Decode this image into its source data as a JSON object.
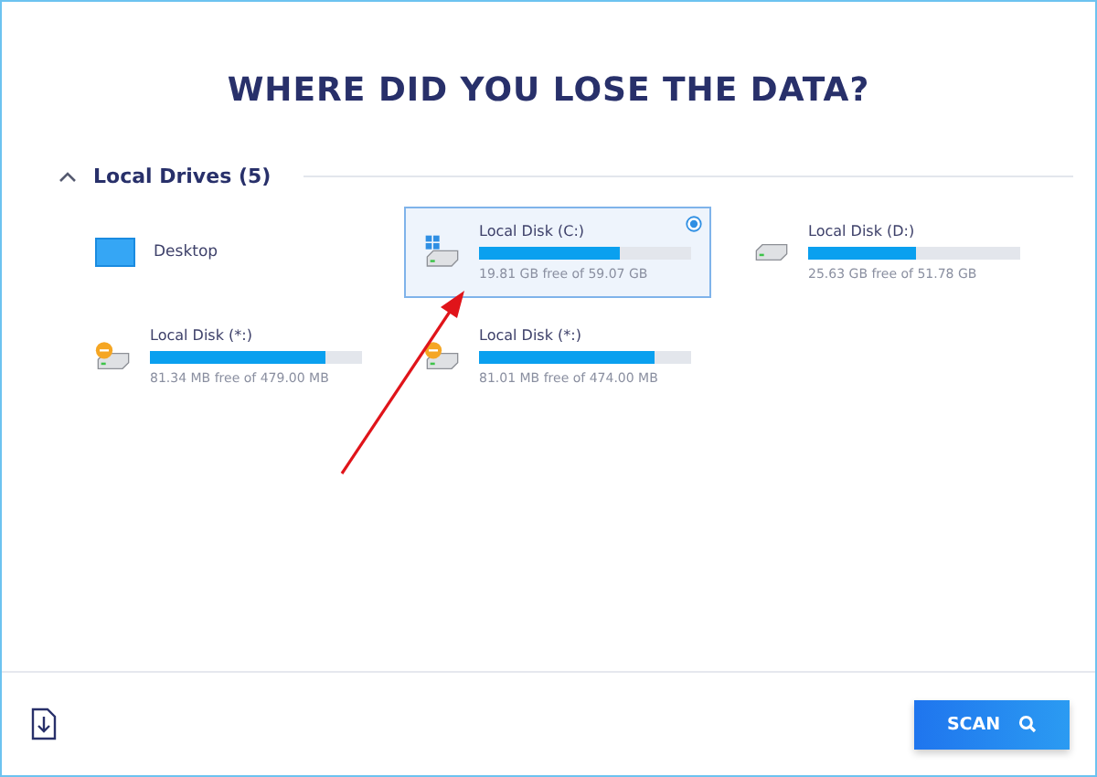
{
  "title": "WHERE DID YOU LOSE THE DATA?",
  "section": {
    "label": "Local Drives (5)",
    "expanded": true
  },
  "drives": [
    {
      "kind": "folder",
      "name": "Desktop",
      "selected": false
    },
    {
      "kind": "system",
      "name": "Local Disk (C:)",
      "level": 0.665,
      "space": "19.81 GB free of 59.07 GB",
      "selected": true
    },
    {
      "kind": "disk",
      "name": "Local Disk (D:)",
      "level": 0.505,
      "space": "25.63 GB free of 51.78 GB",
      "selected": false
    },
    {
      "kind": "warning",
      "name": "Local Disk (*:)",
      "level": 0.83,
      "space": "81.34 MB free of 479.00 MB",
      "selected": false
    },
    {
      "kind": "warning",
      "name": "Local Disk (*:)",
      "level": 0.83,
      "space": "81.01 MB free of 474.00 MB",
      "selected": false
    }
  ],
  "scan_button": "SCAN"
}
